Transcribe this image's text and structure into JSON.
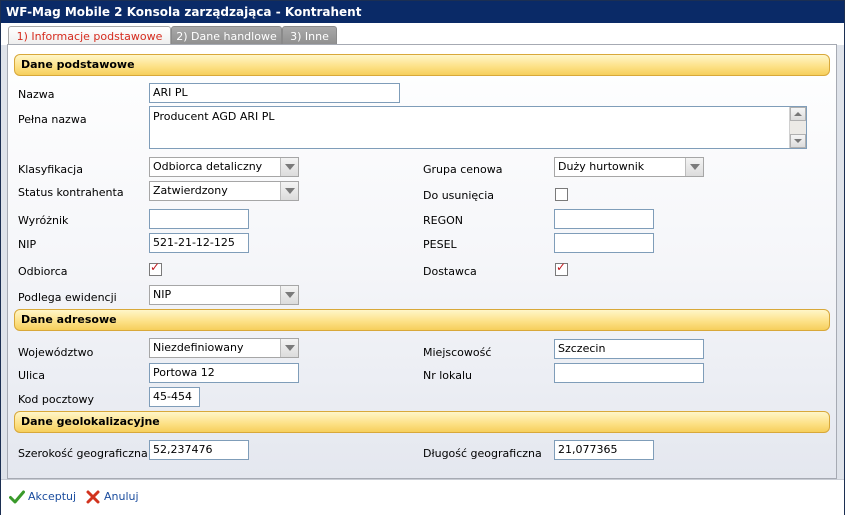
{
  "window": {
    "title": "WF-Mag Mobile 2 Konsola zarządzająca - Kontrahent"
  },
  "tabs": [
    {
      "label": "1) Informacje podstawowe",
      "active": true
    },
    {
      "label": "2) Dane handlowe",
      "active": false
    },
    {
      "label": "3) Inne",
      "active": false
    }
  ],
  "sections": {
    "basic": "Dane podstawowe",
    "address": "Dane adresowe",
    "geo": "Dane geolokalizacyjne"
  },
  "fields": {
    "nazwa": {
      "label": "Nazwa",
      "value": "ARI PL"
    },
    "pelna_nazwa": {
      "label": "Pełna nazwa",
      "value": "Producent AGD ARI PL"
    },
    "klasyfikacja": {
      "label": "Klasyfikacja",
      "value": "Odbiorca detaliczny"
    },
    "grupa_cenowa": {
      "label": "Grupa cenowa",
      "value": "Duży hurtownik"
    },
    "status": {
      "label": "Status kontrahenta",
      "value": "Zatwierdzony"
    },
    "do_usuniecia": {
      "label": "Do usunięcia",
      "checked": false
    },
    "wyroznik": {
      "label": "Wyróżnik",
      "value": ""
    },
    "regon": {
      "label": "REGON",
      "value": ""
    },
    "nip": {
      "label": "NIP",
      "value": "521-21-12-125"
    },
    "pesel": {
      "label": "PESEL",
      "value": ""
    },
    "odbiorca": {
      "label": "Odbiorca",
      "checked": true
    },
    "dostawca": {
      "label": "Dostawca",
      "checked": true
    },
    "podlega_ewidencji": {
      "label": "Podlega ewidencji",
      "value": "NIP"
    },
    "wojewodztwo": {
      "label": "Województwo",
      "value": "Niezdefiniowany"
    },
    "miejscowosc": {
      "label": "Miejscowość",
      "value": "Szczecin"
    },
    "ulica": {
      "label": "Ulica",
      "value": "Portowa 12"
    },
    "nr_lokalu": {
      "label": "Nr lokalu",
      "value": ""
    },
    "kod_pocztowy": {
      "label": "Kod pocztowy",
      "value": "45-454"
    },
    "szerokosc": {
      "label": "Szerokość geograficzna",
      "value": "52,237476"
    },
    "dlugosc": {
      "label": "Długość geograficzna",
      "value": "21,077365"
    }
  },
  "footer": {
    "accept": "Akceptuj",
    "cancel": "Anuluj"
  },
  "icons": {
    "accept": "check-icon",
    "cancel": "cross-icon"
  },
  "colors": {
    "titlebar": "#0a2a67",
    "section": "#fde28a",
    "active_tab_text": "#d62b1e",
    "check": "#c0181e",
    "accept_icon": "#3a9a2a",
    "cancel_icon": "#d2331e"
  }
}
